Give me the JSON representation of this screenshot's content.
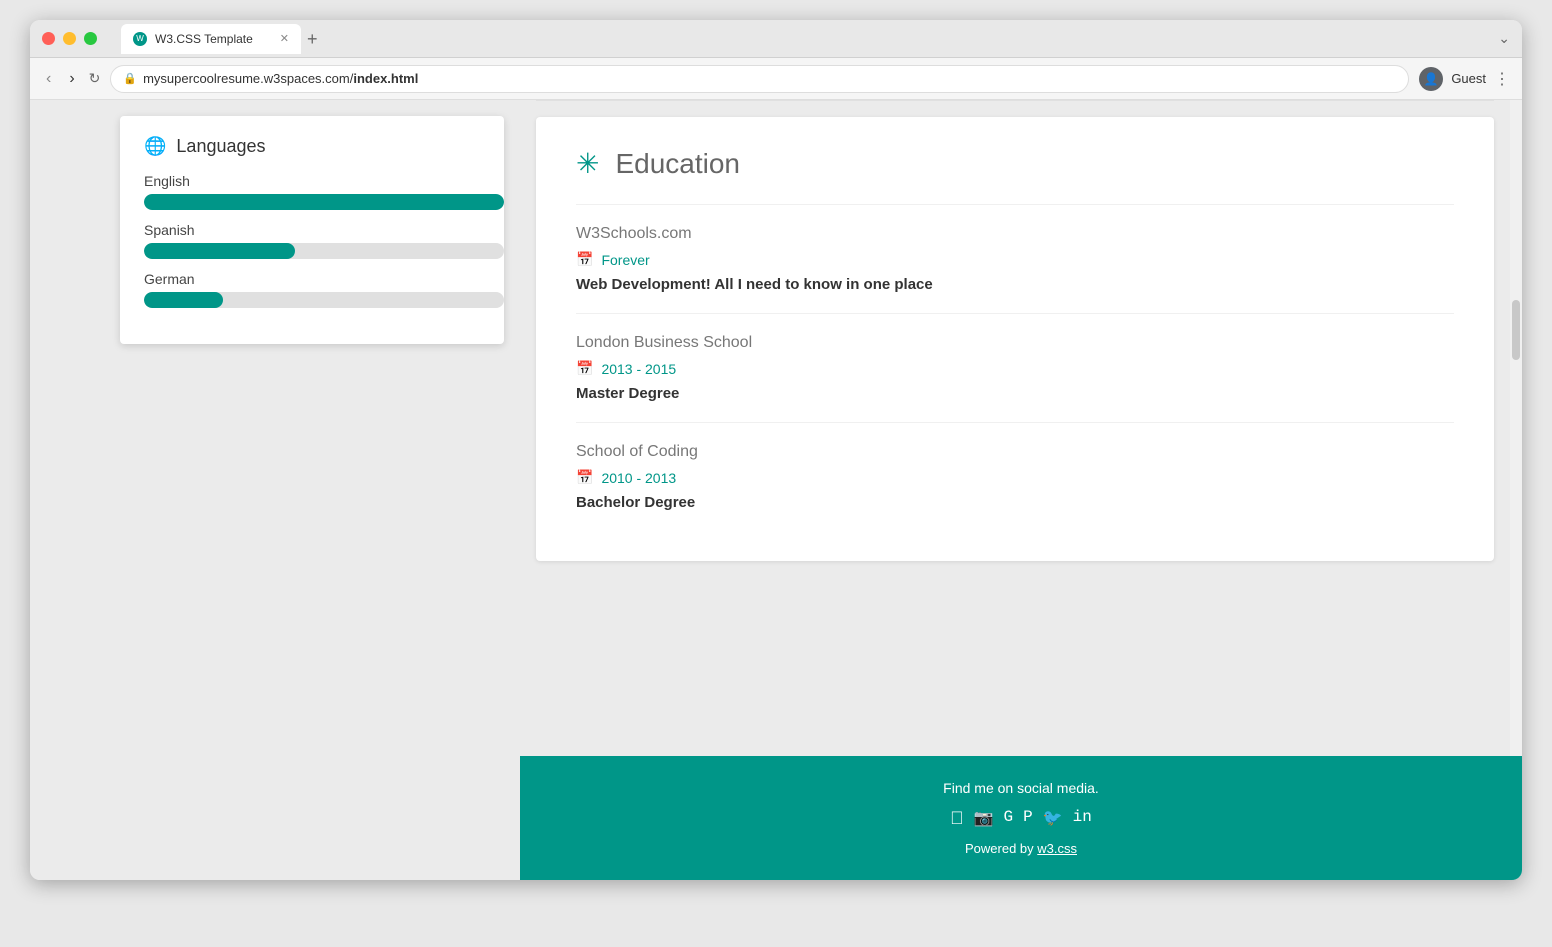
{
  "browser": {
    "tab_title": "W3.CSS Template",
    "url_prefix": "mysupercoolresume.w3spaces.com/",
    "url_path": "index.html",
    "profile": "Guest",
    "new_tab_label": "+"
  },
  "languages": {
    "section_title": "Languages",
    "items": [
      {
        "name": "English",
        "percent": 100
      },
      {
        "name": "Spanish",
        "percent": 42
      },
      {
        "name": "German",
        "percent": 22
      }
    ]
  },
  "education": {
    "section_title": "Education",
    "entries": [
      {
        "school": "W3Schools.com",
        "period": "Forever",
        "description": "Web Development! All I need to know in one place"
      },
      {
        "school": "London Business School",
        "period": "2013 - 2015",
        "description": "Master Degree"
      },
      {
        "school": "School of Coding",
        "period": "2010 - 2013",
        "description": "Bachelor Degree"
      }
    ]
  },
  "footer": {
    "social_text": "Find me on social media.",
    "powered_text": "Powered by ",
    "powered_link": "w3.css"
  }
}
